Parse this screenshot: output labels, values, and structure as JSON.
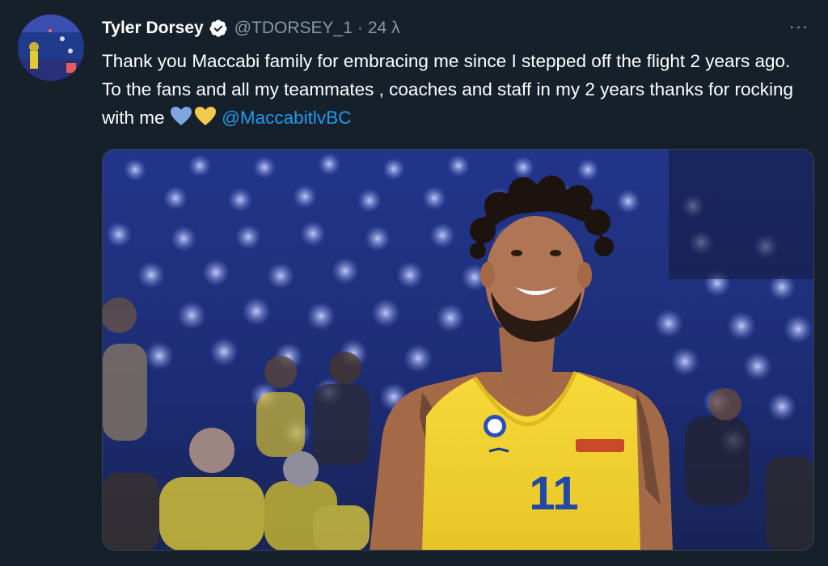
{
  "tweet": {
    "author": {
      "display_name": "Tyler Dorsey",
      "handle": "@TDORSEY_1",
      "verified": true,
      "verified_icon": "verified-badge-icon",
      "avatar_icon": "avatar-photo"
    },
    "separator": "·",
    "timestamp": "24 λ",
    "more_icon": "more-options-icon",
    "more_label": "···",
    "text": "Thank you Maccabi family for embracing me since I stepped off the flight 2 years ago. To the fans and all my teammates , coaches and staff in my 2 years thanks for rocking with me",
    "mention": "@MaccabitlvBC",
    "emoji": [
      {
        "name": "blue-heart-icon",
        "color": "#7ea6e0"
      },
      {
        "name": "yellow-heart-icon",
        "color": "#f2c94c"
      }
    ],
    "media": {
      "type": "photo",
      "jersey_number": "11"
    }
  },
  "colors": {
    "background": "#15202b",
    "text": "#ffffff",
    "muted": "#8899a6",
    "link": "#1d9bf0"
  }
}
